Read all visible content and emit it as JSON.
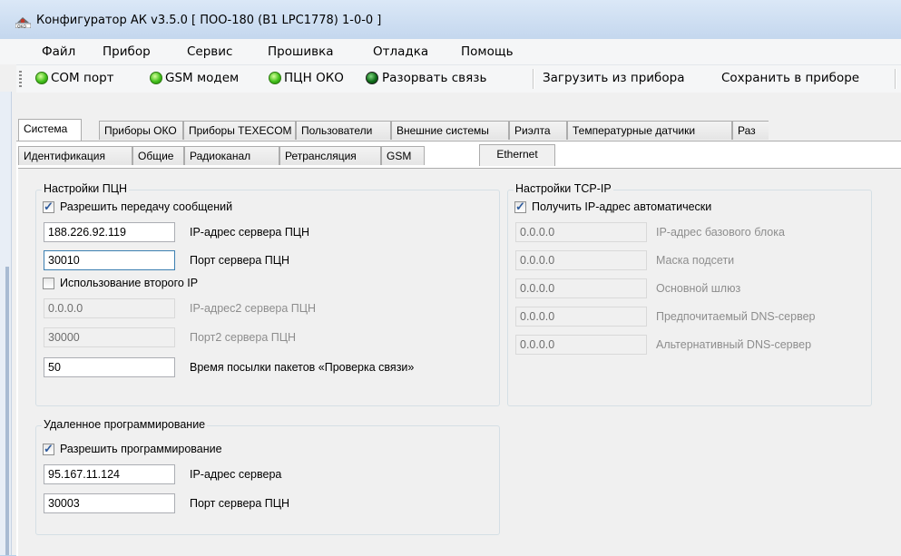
{
  "window": {
    "title": "Конфигуратор АК v3.5.0 [ ПОО-180 (В1 LPC1778) 1-0-0 ]",
    "icon": "oko-app-icon"
  },
  "menu": [
    "Файл",
    "Прибор",
    "Сервис",
    "Прошивка",
    "Отладка",
    "Помощь"
  ],
  "toolbar": {
    "com_port": "COM порт",
    "gsm_modem": "GSM модем",
    "pcn_oko": "ПЦН ОКО",
    "disconnect": "Разорвать связь",
    "load_from_device": "Загрузить из прибора",
    "save_to_device": "Сохранить в приборе"
  },
  "main_tabs": [
    "Система",
    "Приборы ОКО",
    "Приборы TEXECOM",
    "Пользователи",
    "Внешние системы",
    "Риэлта",
    "Температурные датчики",
    "Раз"
  ],
  "main_tab_active": "Система",
  "sub_tabs": [
    "Идентификация",
    "Общие",
    "Радиоканал",
    "Ретрансляция",
    "GSM",
    "Ethernet"
  ],
  "sub_tab_active": "Ethernet",
  "pcn": {
    "title": "Настройки ПЦН",
    "allow_messages": {
      "label": "Разрешить передачу сообщений",
      "checked": true
    },
    "server_ip": {
      "value": "188.226.92.119",
      "label": "IP-адрес сервера ПЦН"
    },
    "server_port": {
      "value": "30010",
      "label": "Порт сервера ПЦН"
    },
    "use_second_ip": {
      "label": "Использование второго IP",
      "checked": false
    },
    "server_ip2": {
      "value": "0.0.0.0",
      "label": "IP-адрес2 сервера ПЦН"
    },
    "server_port2": {
      "value": "30000",
      "label": "Порт2 сервера ПЦН"
    },
    "ping_interval": {
      "value": "50",
      "label": "Время посылки пакетов «Проверка связи»"
    }
  },
  "tcpip": {
    "title": "Настройки TCP-IP",
    "auto_ip": {
      "label": "Получить IP-адрес автоматически",
      "checked": true
    },
    "base_ip": {
      "value": "0.0.0.0",
      "label": "IP-адрес базового блока"
    },
    "subnet_mask": {
      "value": "0.0.0.0",
      "label": "Маска подсети"
    },
    "gateway": {
      "value": "0.0.0.0",
      "label": "Основной шлюз"
    },
    "dns_primary": {
      "value": "0.0.0.0",
      "label": "Предпочитаемый DNS-сервер"
    },
    "dns_alt": {
      "value": "0.0.0.0",
      "label": "Альтернативный DNS-сервер"
    }
  },
  "remote": {
    "title": "Удаленное программирование",
    "allow_programming": {
      "label": "Разрешить программирование",
      "checked": true
    },
    "server_ip": {
      "value": "95.167.11.124",
      "label": "IP-адрес сервера"
    },
    "server_port": {
      "value": "30003",
      "label": "Порт сервера ПЦН"
    }
  }
}
